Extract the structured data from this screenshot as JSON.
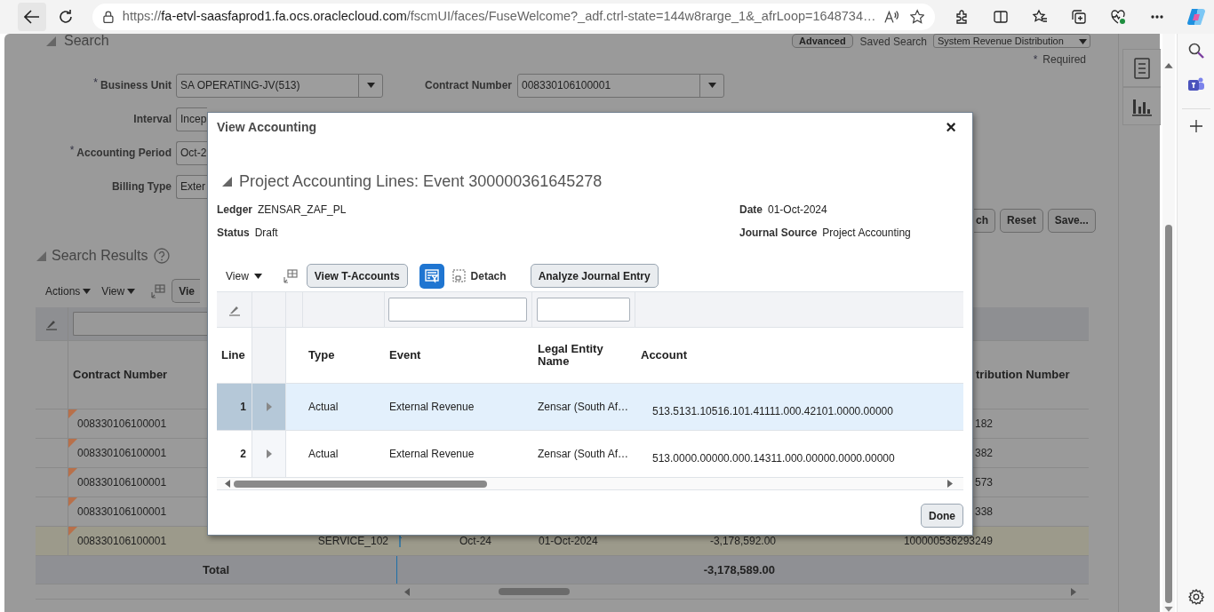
{
  "browser": {
    "url_scheme": "https://",
    "url_host": "fa-etvl-saasfaprod1.fa.ocs.oraclecloud.com",
    "url_rest": "/fscmUI/faces/FuseWelcome?_adf.ctrl-state=144w8rarge_1&_afrLoop=1648734…"
  },
  "search_panel": {
    "title": "Search",
    "advanced_button": "Advanced",
    "saved_search_label": "Saved Search",
    "saved_search_value": "System Revenue Distribution",
    "required_mark": "*",
    "required_note": "Required",
    "fields_left": [
      {
        "label": "Business Unit",
        "required_mark": "*",
        "value": "SA OPERATING-JV(513)",
        "dropdown": true
      },
      {
        "label": "Interval",
        "value": "Incep",
        "dropdown": false
      },
      {
        "label": "Accounting Period",
        "required_mark": "*",
        "value": "Oct-2",
        "dropdown": false
      },
      {
        "label": "Billing Type",
        "value": "Exter",
        "dropdown": false
      }
    ],
    "fields_right": [
      {
        "label": "Contract Number",
        "value": "008330106100001",
        "dropdown": true
      }
    ],
    "buttons": [
      "ch",
      "Reset",
      "Save..."
    ]
  },
  "results": {
    "title": "Search Results",
    "menus": [
      "Actions",
      "View"
    ],
    "partial_button": "Vie",
    "columns": {
      "contract": "Contract Number",
      "distribution": "tribution Number"
    },
    "rows": [
      {
        "contract": "008330106100001",
        "distribution": "182",
        "selected": false
      },
      {
        "contract": "008330106100001",
        "distribution": "382",
        "selected": false
      },
      {
        "contract": "008330106100001",
        "distribution": "573",
        "selected": false
      },
      {
        "contract": "008330106100001",
        "distribution": "338",
        "selected": false
      },
      {
        "contract": "008330106100001",
        "service": "SERVICE_102",
        "period": "Oct-24",
        "date": "01-Oct-2024",
        "amount": "-3,178,592.00",
        "distribution": "100000536293249",
        "selected": true
      }
    ],
    "total": {
      "label": "Total",
      "amount": "-3,178,589.00"
    }
  },
  "dialog": {
    "title": "View Accounting",
    "close": "×",
    "section_title": "Project Accounting Lines: Event 300000361645278",
    "info_left": [
      {
        "label": "Ledger",
        "value": "ZENSAR_ZAF_PL"
      },
      {
        "label": "Status",
        "value": "Draft"
      }
    ],
    "info_right": [
      {
        "label": "Date",
        "value": "01-Oct-2024"
      },
      {
        "label": "Journal Source",
        "value": "Project Accounting"
      }
    ],
    "toolbar": {
      "view_menu": "View",
      "t_accounts_button": "View T-Accounts",
      "filter_on": true,
      "detach": "Detach",
      "analyze_button": "Analyze Journal Entry"
    },
    "columns": {
      "line": "Line",
      "type": "Type",
      "event": "Event",
      "legal_entity": "Legal Entity Name",
      "account": "Account"
    },
    "rows": [
      {
        "line": "1",
        "type": "Actual",
        "event": "External Revenue",
        "legal_entity": "Zensar (South Af…",
        "account": "513.5131.10516.101.41111.000.42101.0000.00000",
        "selected": true
      },
      {
        "line": "2",
        "type": "Actual",
        "event": "External Revenue",
        "legal_entity": "Zensar (South Af…",
        "account": "513.0000.00000.000.14311.000.00000.0000.00000",
        "selected": false
      }
    ],
    "done_button": "Done"
  }
}
